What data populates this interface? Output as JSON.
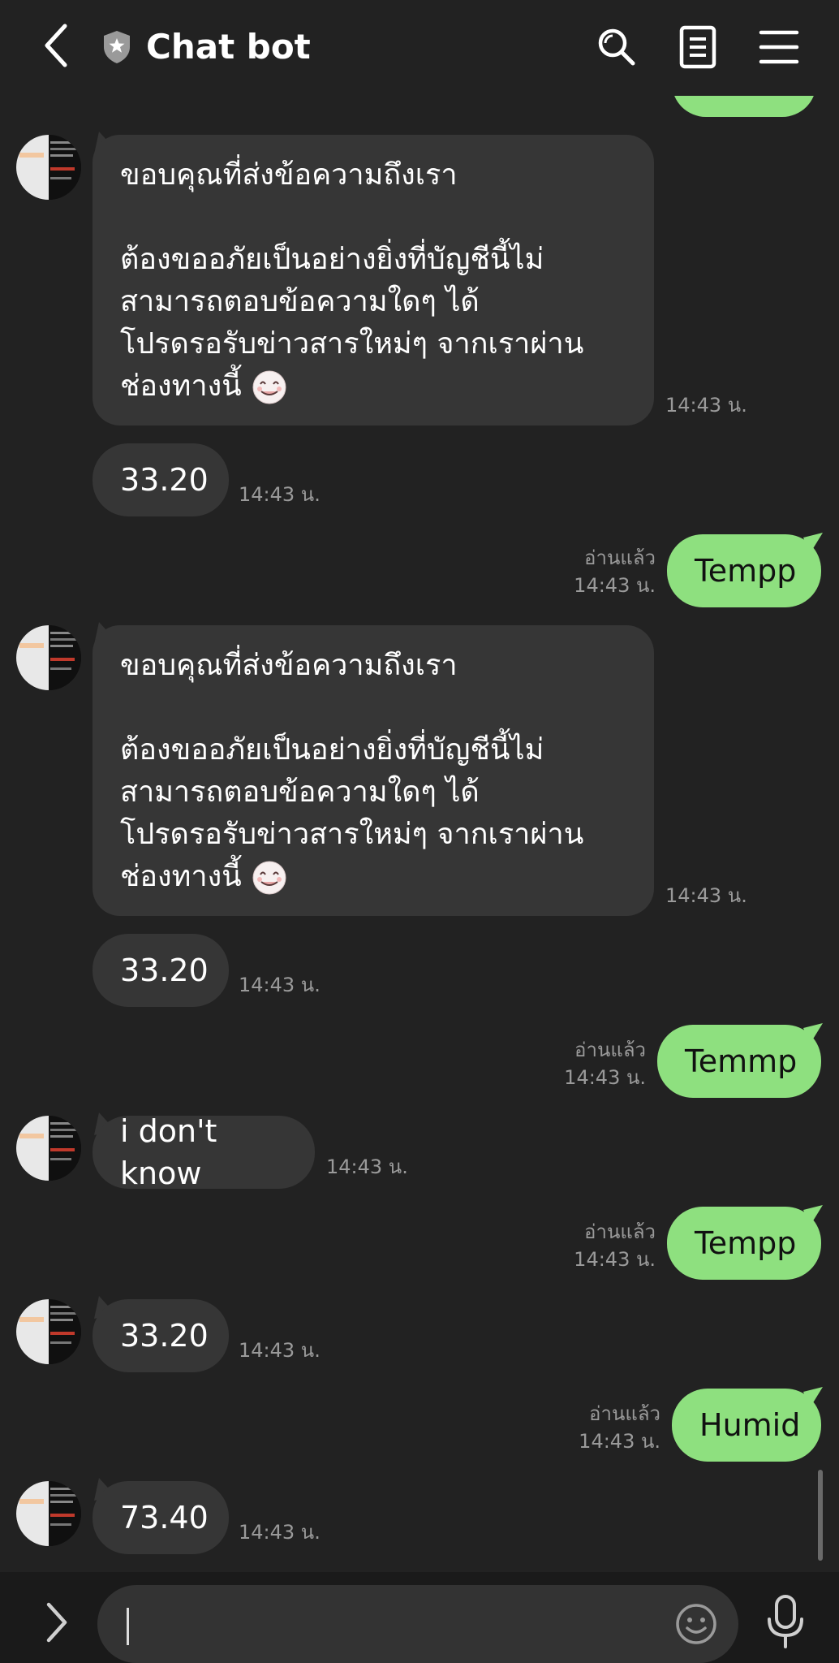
{
  "header": {
    "title": "Chat bot",
    "back_icon": "chevron-left-icon",
    "badge_icon": "shield-star-icon",
    "actions": [
      "search-icon",
      "notes-icon",
      "menu-icon"
    ]
  },
  "messages": [
    {
      "from": "bot",
      "lines": [
        "ขอบคุณที่ส่งข้อความถึงเรา"
      ],
      "lines2": [
        "ต้องขออภัยเป็นอย่างยิ่งที่บัญชีนี้ไม่",
        "สามารถตอบข้อความใดๆ ได้",
        "โปรดรอรับข่าวสารใหม่ๆ จากเราผ่าน",
        "ช่องทางนี้"
      ],
      "time": "14:43 น."
    },
    {
      "from": "bot",
      "text": "33.20",
      "time": "14:43 น."
    },
    {
      "from": "me",
      "text": "Tempp",
      "read": "อ่านแล้ว",
      "time": "14:43 น."
    },
    {
      "from": "bot",
      "lines": [
        "ขอบคุณที่ส่งข้อความถึงเรา"
      ],
      "lines2": [
        "ต้องขออภัยเป็นอย่างยิ่งที่บัญชีนี้ไม่",
        "สามารถตอบข้อความใดๆ ได้",
        "โปรดรอรับข่าวสารใหม่ๆ จากเราผ่าน",
        "ช่องทางนี้"
      ],
      "time": "14:43 น."
    },
    {
      "from": "bot",
      "text": "33.20",
      "time": "14:43 น."
    },
    {
      "from": "me",
      "text": "Temmp",
      "read": "อ่านแล้ว",
      "time": "14:43 น."
    },
    {
      "from": "bot",
      "text": "i don't know",
      "time": "14:43 น."
    },
    {
      "from": "me",
      "text": "Tempp",
      "read": "อ่านแล้ว",
      "time": "14:43 น."
    },
    {
      "from": "bot",
      "text": "33.20",
      "time": "14:43 น."
    },
    {
      "from": "me",
      "text": "Humid",
      "read": "อ่านแล้ว",
      "time": "14:43 น."
    },
    {
      "from": "bot",
      "text": "73.40",
      "time": "14:43 น."
    }
  ],
  "composer": {
    "expand_icon": "chevron-right-icon",
    "emoji_icon": "smiley-icon",
    "mic_icon": "microphone-icon",
    "value": ""
  },
  "colors": {
    "background": "#222222",
    "incoming_bubble": "#363636",
    "outgoing_bubble": "#8ee07f",
    "muted_text": "#9a9a9a"
  }
}
